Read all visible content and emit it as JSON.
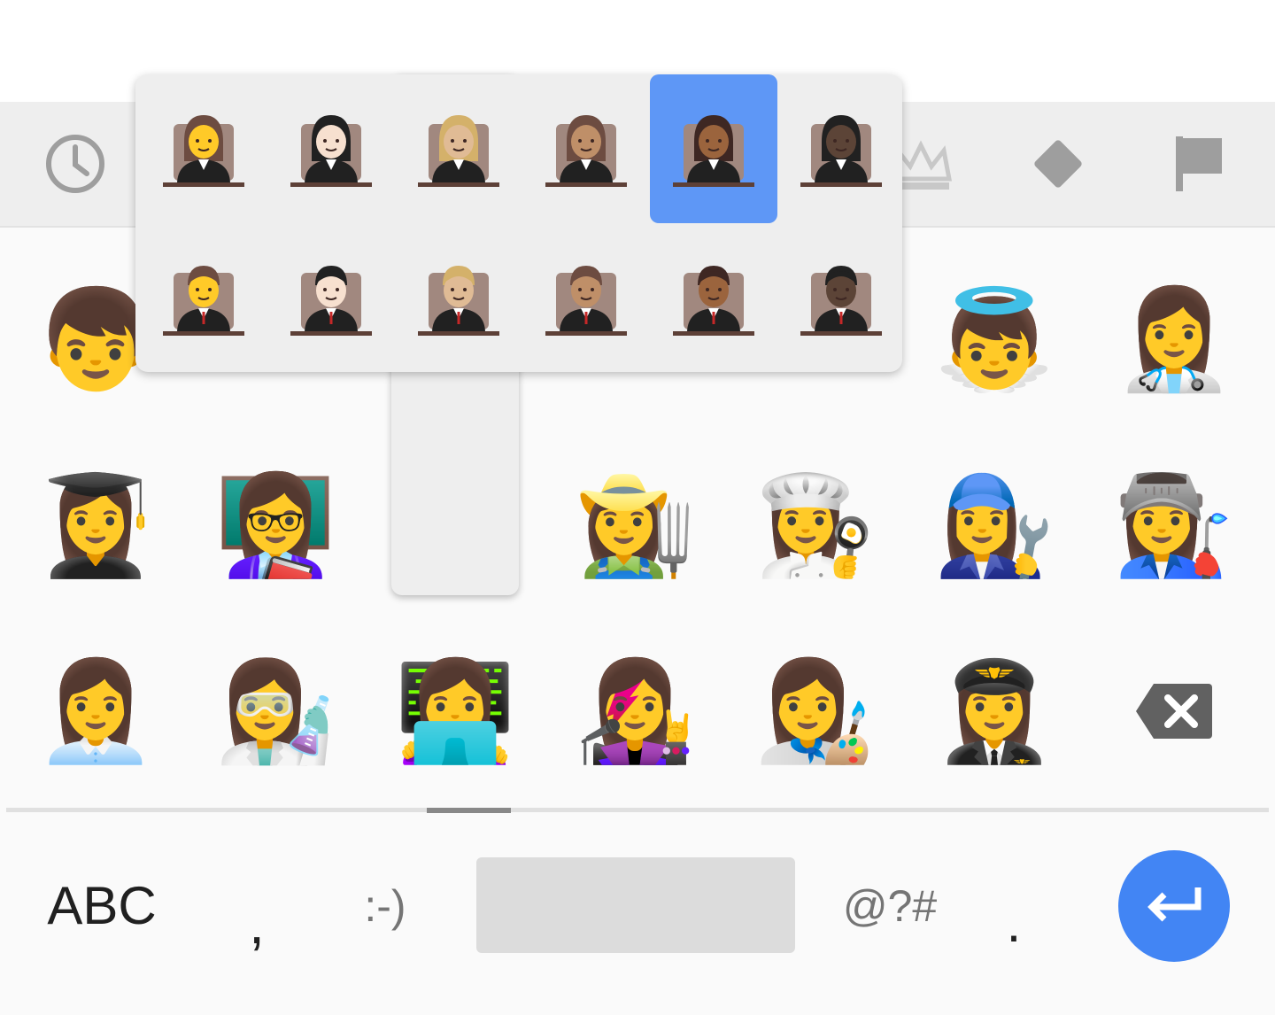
{
  "categories": [
    {
      "icon": "clock-icon",
      "label": "Recent"
    },
    {
      "icon": "crown-icon",
      "label": "Objects"
    },
    {
      "icon": "diamond-icon",
      "label": "Symbols"
    },
    {
      "icon": "flag-icon",
      "label": "Flags"
    }
  ],
  "grid": {
    "rows": [
      [
        "👦",
        "",
        "",
        "",
        "",
        "👼",
        "👩‍⚕️"
      ],
      [
        "👩‍🎓",
        "👩‍🏫",
        "",
        "👩‍🌾",
        "👩‍🍳",
        "👩‍🔧",
        "👩‍🏭"
      ],
      [
        "👩‍💼",
        "👩‍🔬",
        "👩‍💻",
        "👩‍🎤",
        "👩‍🎨",
        "👩‍✈️",
        ""
      ]
    ],
    "backspace_icon": "backspace-icon"
  },
  "skin_tone_popup": {
    "female": [
      "👩‍⚖️",
      "👩🏻‍⚖️",
      "👩🏼‍⚖️",
      "👩🏽‍⚖️",
      "👩🏾‍⚖️",
      "👩🏿‍⚖️"
    ],
    "male": [
      "👨‍⚖️",
      "👨🏻‍⚖️",
      "👨🏼‍⚖️",
      "👨🏽‍⚖️",
      "👨🏾‍⚖️",
      "👨🏿‍⚖️"
    ],
    "selected_index": 4,
    "selected_row": "female",
    "skin_colors": [
      "#ffca28",
      "#f7e0cf",
      "#e0bb95",
      "#bf8f68",
      "#9b643d",
      "#5c4437"
    ],
    "hair_female": [
      "#6d4c41",
      "#212121",
      "#d4b16a",
      "#6d4c41",
      "#3e2723",
      "#212121"
    ],
    "hair_male": [
      "#6d4c41",
      "#212121",
      "#d4b16a",
      "#6d4c41",
      "#3e2723",
      "#212121"
    ]
  },
  "bottom_bar": {
    "abc_label": "ABC",
    "comma_label": ",",
    "smiley_label": ":-)",
    "symbols_label": "@?#",
    "period_label": ".",
    "enter_icon": "enter-icon"
  },
  "colors": {
    "accent": "#4285f4",
    "selected": "#5e97f6"
  }
}
